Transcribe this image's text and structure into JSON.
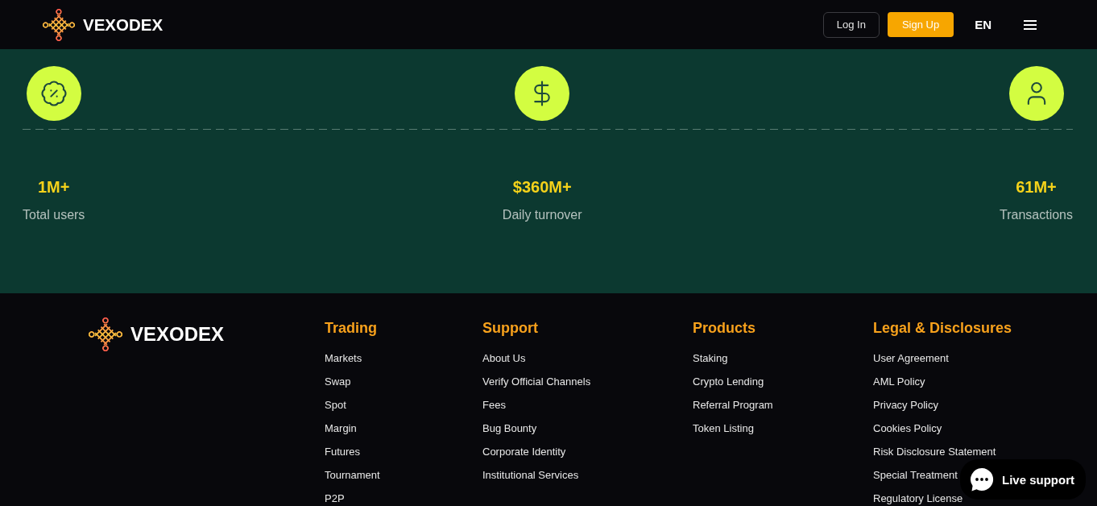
{
  "header": {
    "brand": "VEXODEX",
    "buttons": [
      {
        "label": "Log In",
        "kind": "outline"
      },
      {
        "label": "Sign Up",
        "kind": "primary"
      }
    ],
    "language": "EN"
  },
  "stats": [
    {
      "value": "1M+",
      "label": "Total users"
    },
    {
      "value": "$360M+",
      "label": "Daily turnover"
    },
    {
      "value": "61M+",
      "label": "Transactions"
    }
  ],
  "footer": {
    "brand": "VEXODEX",
    "columns": [
      {
        "title": "Trading",
        "links": [
          "Markets",
          "Swap",
          "Spot",
          "Margin",
          "Futures",
          "Tournament",
          "P2P"
        ]
      },
      {
        "title": "Support",
        "links": [
          "About Us",
          "Verify Official Channels",
          "Fees",
          "Bug Bounty",
          "Corporate Identity",
          "Institutional Services"
        ]
      },
      {
        "title": "Products",
        "links": [
          "Staking",
          "Crypto Lending",
          "Referral Program",
          "Token Listing"
        ]
      },
      {
        "title": "Legal & Disclosures",
        "links": [
          "User Agreement",
          "AML Policy",
          "Privacy Policy",
          "Cookies Policy",
          "Risk Disclosure Statement",
          "Special Treatment",
          "Regulatory License"
        ]
      }
    ]
  },
  "live_support": {
    "label": "Live support"
  }
}
